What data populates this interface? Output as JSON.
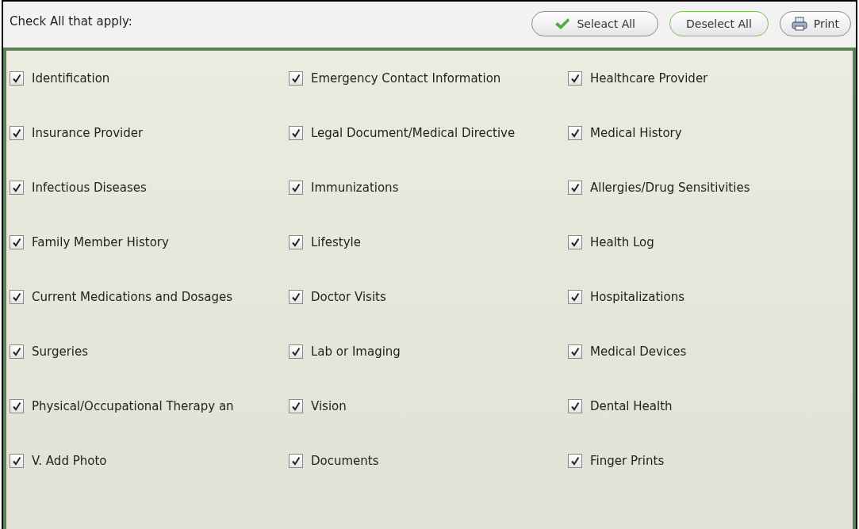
{
  "header": {
    "title": "Check All that apply:"
  },
  "buttons": [
    {
      "kind": "select",
      "label": "Seleact All"
    },
    {
      "kind": "deselect",
      "label": "Deselect All"
    },
    {
      "kind": "print",
      "label": "Print"
    }
  ],
  "items": [
    {
      "label": "Identification",
      "checked": true
    },
    {
      "label": "Emergency Contact Information",
      "checked": true
    },
    {
      "label": "Healthcare Provider",
      "checked": true
    },
    {
      "label": "Insurance Provider",
      "checked": true
    },
    {
      "label": "Legal Document/Medical Directive",
      "checked": true
    },
    {
      "label": "Medical History",
      "checked": true
    },
    {
      "label": "Infectious Diseases",
      "checked": true
    },
    {
      "label": "Immunizations",
      "checked": true
    },
    {
      "label": "Allergies/Drug Sensitivities",
      "checked": true
    },
    {
      "label": "Family Member History",
      "checked": true
    },
    {
      "label": "Lifestyle",
      "checked": true
    },
    {
      "label": "Health Log",
      "checked": true
    },
    {
      "label": "Current Medications and Dosages",
      "checked": true
    },
    {
      "label": "Doctor Visits",
      "checked": true
    },
    {
      "label": "Hospitalizations",
      "checked": true
    },
    {
      "label": "Surgeries",
      "checked": true
    },
    {
      "label": "Lab or Imaging",
      "checked": true
    },
    {
      "label": "Medical Devices",
      "checked": true
    },
    {
      "label": "Physical/Occupational Therapy an",
      "checked": true
    },
    {
      "label": "Vision",
      "checked": true
    },
    {
      "label": "Dental Health",
      "checked": true
    },
    {
      "label": "V. Add Photo",
      "checked": true
    },
    {
      "label": "Documents",
      "checked": true
    },
    {
      "label": "Finger Prints",
      "checked": true
    }
  ]
}
